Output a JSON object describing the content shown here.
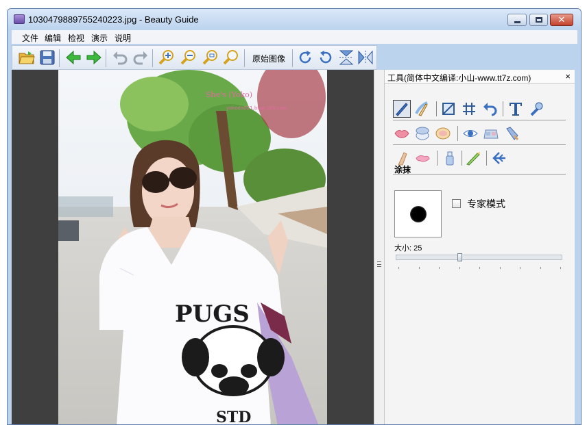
{
  "window": {
    "title": "1030479889755240223.jpg - Beauty Guide",
    "min_glyph": "–",
    "max_glyph": "□",
    "close_glyph": "✕"
  },
  "menu": [
    "文件",
    "编辑",
    "检视",
    "演示",
    "说明"
  ],
  "toolbar": {
    "original_image_label": "原始图像",
    "icons": [
      "open-folder",
      "save",
      "back-arrow",
      "forward-arrow",
      "undo",
      "redo",
      "zoom-in",
      "zoom-out",
      "zoom-fit",
      "zoom-actual",
      "rotate-clockwise",
      "rotate-counterclockwise",
      "flip-vertical",
      "flip-horizontal"
    ]
  },
  "photo": {
    "watermark_line1": "She's (Yoko)",
    "watermark_line2": "yokoda021.blog.163.com",
    "shirt_text": "PUGS",
    "shirt_text2": "STD"
  },
  "panel": {
    "title": "工具(简体中文编译:小山-www.tt7z.com)",
    "close": "×",
    "section_label": "涂抹",
    "expert_mode_label": "专家模式",
    "expert_mode_checked": false,
    "size_label": "大小: 25",
    "size_value": 25,
    "size_max": 100,
    "row1_icons": [
      "brush-tool",
      "smudge-tool",
      "crop-tool",
      "grid-tool",
      "undo-tool",
      "text-tool",
      "wrench-tool"
    ],
    "row2_icons": [
      "lips-icon",
      "compact-powder-icon",
      "blush-compact-icon",
      "eye-icon",
      "eyeshadow-palette-icon",
      "mascara-icon"
    ],
    "row3_icons": [
      "foundation-brush-icon",
      "lip-gloss-icon",
      "bottle-icon",
      "liner-brush-icon",
      "arrow-in-icon"
    ]
  },
  "colors": {
    "titlebar": "#bcd3ee",
    "viewer_bg": "#3f3f3f",
    "panel_bg": "#f4f4f4",
    "arrow_green": "#3cb83c"
  }
}
